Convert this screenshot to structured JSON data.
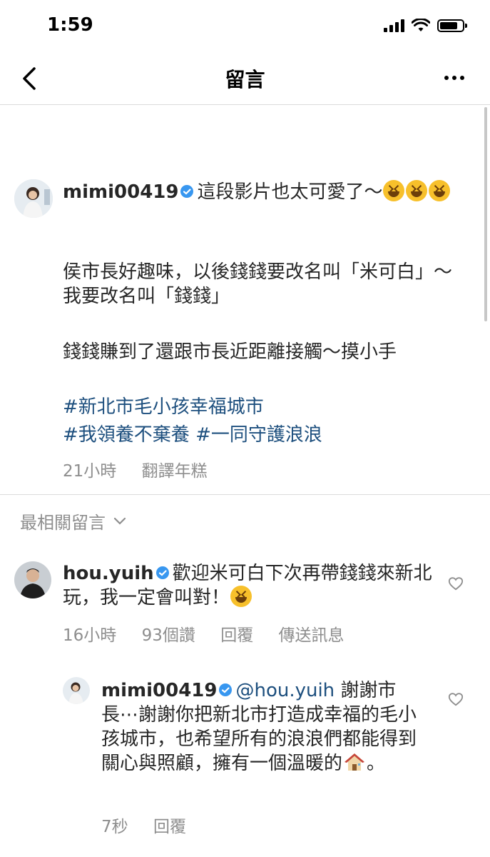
{
  "status_bar": {
    "time": "1:59"
  },
  "header": {
    "title": "留言"
  },
  "post": {
    "username": "mimi00419",
    "caption_text": "這段影片也太可愛了～",
    "paragraph1": "侯市長好趣味，以後錢錢要改名叫「米可白」～我要改名叫「錢錢」",
    "paragraph2": "錢錢賺到了還跟市長近距離接觸～摸小手",
    "hashtag1": "#新北市毛小孩幸福城市",
    "hashtag2": "#我領養不棄養",
    "hashtag3": "#一同守護浪浪",
    "time_ago": "21小時",
    "translate_label": "翻譯年糕"
  },
  "sort": {
    "label": "最相關留言"
  },
  "comments": [
    {
      "username": "hou.yuih",
      "text": "歡迎米可白下次再帶錢錢來新北玩，我一定會叫對！",
      "time_ago": "16小時",
      "likes": "93個讚",
      "reply_label": "回覆",
      "send_label": "傳送訊息"
    },
    {
      "username": "mimi00419",
      "mention": "@hou.yuih",
      "text": " 謝謝市長⋯謝謝你把新北市打造成幸福的毛小孩城市，也希望所有的浪浪們都能得到關心與照顧，擁有一個溫暖的",
      "text_end": "。",
      "time_ago": "7秒",
      "reply_label": "回覆"
    }
  ],
  "icons": [
    "back-arrow-icon",
    "more-options-icon",
    "verified-badge-icon",
    "grinning-squinting-emoji-icon",
    "chevron-down-icon",
    "heart-icon",
    "house-emoji-icon"
  ],
  "colors": {
    "hashtag": "#1d4f7e",
    "verified": "#3897f0",
    "secondary_text": "#8e8e8e"
  }
}
